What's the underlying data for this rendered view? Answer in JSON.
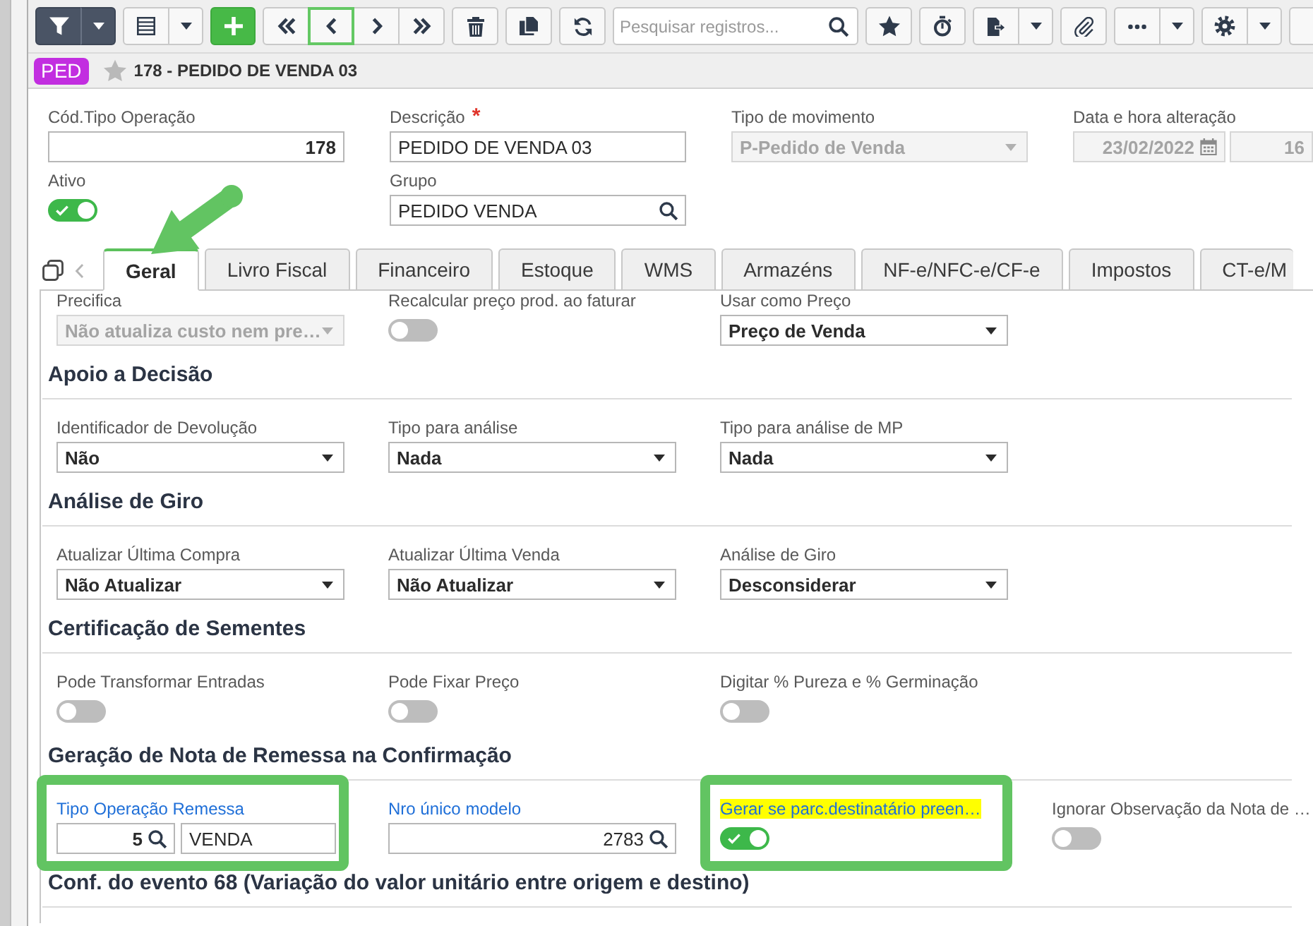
{
  "toolbar": {
    "groups": [
      {
        "kind": "dark",
        "buttons": [
          {
            "kind": "filter",
            "highlighted": false
          },
          {
            "kind": "caret",
            "highlighted": false
          }
        ]
      },
      {
        "kind": "plain",
        "buttons": [
          {
            "kind": "grid",
            "highlighted": false
          },
          {
            "kind": "caret",
            "highlighted": false
          }
        ]
      },
      {
        "kind": "primary",
        "buttons": [
          {
            "kind": "add",
            "highlighted": false
          }
        ]
      },
      {
        "kind": "plain",
        "buttons": [
          {
            "kind": "first",
            "highlighted": false
          },
          {
            "kind": "prev",
            "highlighted": true
          },
          {
            "kind": "next",
            "highlighted": false
          },
          {
            "kind": "last",
            "highlighted": false
          }
        ]
      },
      {
        "kind": "plain",
        "buttons": [
          {
            "kind": "delete",
            "highlighted": false
          }
        ]
      },
      {
        "kind": "plain",
        "buttons": [
          {
            "kind": "copy",
            "highlighted": false
          }
        ]
      },
      {
        "kind": "plain",
        "buttons": [
          {
            "kind": "refresh",
            "highlighted": false
          }
        ]
      },
      {
        "kind": "search",
        "placeholder": "Pesquisar registros..."
      },
      {
        "kind": "plain",
        "buttons": [
          {
            "kind": "favorite",
            "highlighted": false
          }
        ]
      },
      {
        "kind": "plain",
        "buttons": [
          {
            "kind": "timer",
            "highlighted": false
          }
        ]
      },
      {
        "kind": "plain",
        "buttons": [
          {
            "kind": "export",
            "highlighted": false
          },
          {
            "kind": "caret",
            "highlighted": false
          }
        ]
      },
      {
        "kind": "plain",
        "buttons": [
          {
            "kind": "attach",
            "highlighted": false
          }
        ]
      },
      {
        "kind": "plain",
        "buttons": [
          {
            "kind": "more",
            "highlighted": false
          },
          {
            "kind": "caret",
            "highlighted": false
          }
        ]
      },
      {
        "kind": "plain",
        "buttons": [
          {
            "kind": "settings",
            "highlighted": false
          },
          {
            "kind": "caret",
            "highlighted": false
          }
        ]
      },
      {
        "kind": "edge",
        "buttons": [
          {
            "kind": "blank",
            "highlighted": false
          }
        ]
      }
    ]
  },
  "record": {
    "badge": "PED",
    "favorite": false,
    "title": "178 - PEDIDO DE VENDA 03"
  },
  "header_rows": [
    [
      {
        "kind": "number",
        "label": "Cód.Tipo Operação",
        "value": "178"
      },
      {
        "kind": "text",
        "label": "Descrição",
        "required_mark": "*",
        "value": "PEDIDO DE VENDA 03"
      },
      {
        "kind": "select",
        "label": "Tipo de movimento",
        "value": "P-Pedido de Venda",
        "disabled": true
      },
      {
        "kind": "datetime",
        "label": "Data e hora alteração",
        "date": "23/02/2022",
        "time": "16",
        "disabled": true
      }
    ],
    [
      {
        "kind": "toggle",
        "label": "Ativo",
        "on": true
      },
      {
        "kind": "lookup",
        "label": "Grupo",
        "value": "PEDIDO VENDA"
      }
    ]
  ],
  "tabs": [
    {
      "label": "Geral",
      "selected": true,
      "arrow": true
    },
    {
      "label": "Livro Fiscal",
      "selected": false,
      "arrow": false
    },
    {
      "label": "Financeiro",
      "selected": false,
      "arrow": false
    },
    {
      "label": "Estoque",
      "selected": false,
      "arrow": false
    },
    {
      "label": "WMS",
      "selected": false,
      "arrow": false
    },
    {
      "label": "Armazéns",
      "selected": false,
      "arrow": false
    },
    {
      "label": "NF-e/NFC-e/CF-e",
      "selected": false,
      "arrow": false
    },
    {
      "label": "Impostos",
      "selected": false,
      "arrow": false
    },
    {
      "label": "CT-e/M",
      "selected": false,
      "arrow": false
    }
  ],
  "sections": [
    {
      "fields": [
        {
          "kind": "select",
          "label": "Precifica",
          "value": "Não atualiza custo nem pre…",
          "disabled": true
        },
        {
          "kind": "toggle",
          "label": "Recalcular preço prod. ao faturar",
          "on": false
        },
        {
          "kind": "select",
          "label": "Usar como Preço",
          "value": "Preço de Venda",
          "disabled": false
        }
      ]
    },
    {
      "title": "Apoio a Decisão",
      "fields": [
        {
          "kind": "select",
          "label": "Identificador de Devolução",
          "value": "Não",
          "disabled": false
        },
        {
          "kind": "select",
          "label": "Tipo para análise",
          "value": "Nada",
          "disabled": false
        },
        {
          "kind": "select",
          "label": "Tipo para análise de MP",
          "value": "Nada",
          "disabled": false
        }
      ]
    },
    {
      "title": "Análise de Giro",
      "fields": [
        {
          "kind": "select",
          "label": "Atualizar Última Compra",
          "value": "Não Atualizar",
          "disabled": false
        },
        {
          "kind": "select",
          "label": "Atualizar Última Venda",
          "value": "Não Atualizar",
          "disabled": false
        },
        {
          "kind": "select",
          "label": "Análise de Giro",
          "value": "Desconsiderar",
          "disabled": false
        }
      ]
    },
    {
      "title": "Certificação de Sementes",
      "fields": [
        {
          "kind": "toggle",
          "label": "Pode Transformar Entradas",
          "on": false
        },
        {
          "kind": "toggle",
          "label": "Pode Fixar Preço",
          "on": false
        },
        {
          "kind": "toggle",
          "label": "Digitar % Pureza e % Germinação",
          "on": false
        }
      ]
    },
    {
      "title": "Geração de Nota de Remessa na Confirmação",
      "fields": [
        {
          "kind": "lookup_pair",
          "label": "Tipo Operação Remessa",
          "link": true,
          "marked": false,
          "highlighted": true,
          "code": "5",
          "name": "VENDA"
        },
        {
          "kind": "number_lookup",
          "label": "Nro único modelo",
          "link": true,
          "marked": false,
          "highlighted": false,
          "value": "2783"
        },
        {
          "kind": "toggle",
          "label": "Gerar se parc.destinatário preen…",
          "link": true,
          "marked": true,
          "highlighted": true,
          "on": true
        },
        {
          "kind": "toggle",
          "label": "Ignorar Observação da Nota de …",
          "link": false,
          "marked": false,
          "highlighted": false,
          "on": false
        }
      ]
    },
    {
      "title": "Conf. do evento 68 (Variação do valor unitário entre origem e destino)"
    }
  ]
}
